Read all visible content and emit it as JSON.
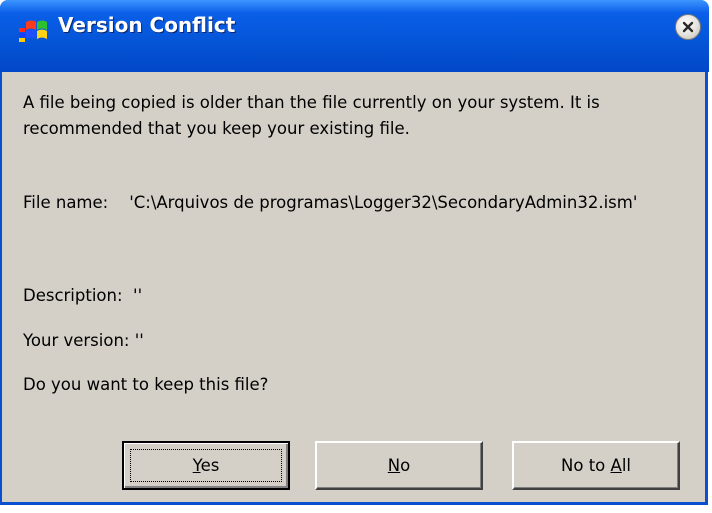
{
  "window": {
    "title": "Version Conflict",
    "title_icon": "windows-installer-icon",
    "close_icon": "close-icon"
  },
  "message": {
    "line1": "A file being copied is older than the file currently on your system.  It is recommended that you keep your existing file.",
    "file_label": "File name:",
    "file_value": "'C:\\Arquivos de programas\\Logger32\\SecondaryAdmin32.ism'",
    "description_label": "Description:",
    "description_value": "''",
    "version_label": "Your version:",
    "version_value": "''",
    "question": "Do you want to keep this file?"
  },
  "buttons": {
    "yes_mnemonic": "Y",
    "yes_rest": "es",
    "no_mnemonic": "N",
    "no_rest": "o",
    "noall_prefix": "No to ",
    "noall_mnemonic": "A",
    "noall_rest": "ll"
  },
  "colors": {
    "titlebar": "#0454d6",
    "dialog_bg": "#d4d0c8"
  }
}
